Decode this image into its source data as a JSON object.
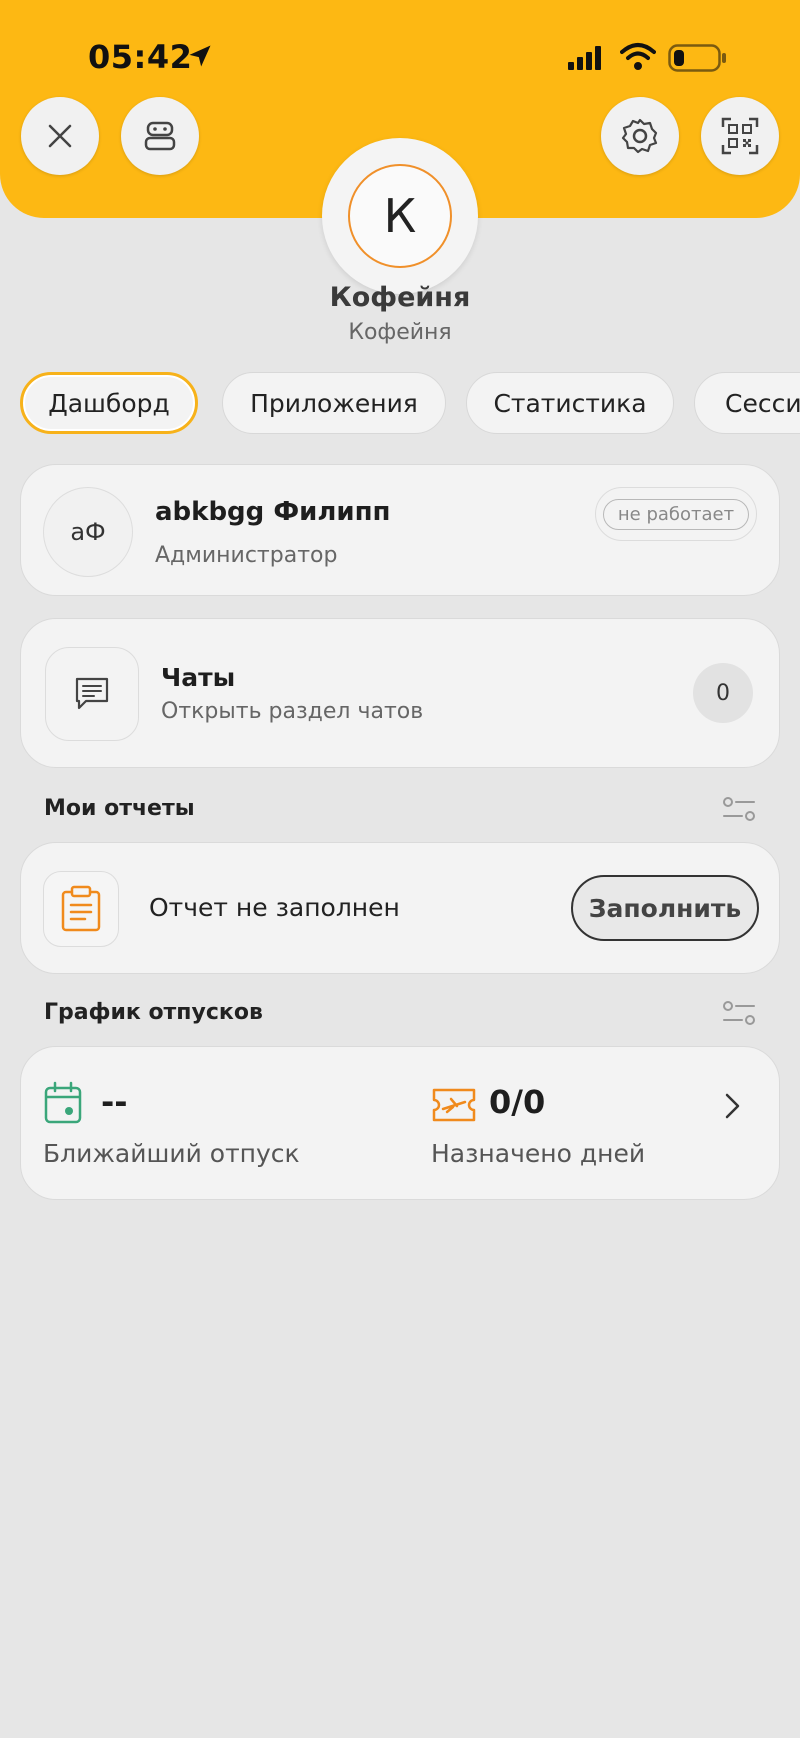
{
  "status_bar": {
    "time": "05:42"
  },
  "header": {
    "avatar_letter": "К",
    "org_name": "Кофейня",
    "org_subtitle": "Кофейня"
  },
  "tabs": [
    {
      "label": "Дашборд",
      "active": true
    },
    {
      "label": "Приложения",
      "active": false
    },
    {
      "label": "Статистика",
      "active": false
    },
    {
      "label": "Сессии",
      "active": false
    }
  ],
  "user_card": {
    "initials": "аФ",
    "name": "abkbgg Филипп",
    "role": "Администратор",
    "status": "не работает"
  },
  "chats_card": {
    "title": "Чаты",
    "subtitle": "Открыть раздел чатов",
    "count": "0"
  },
  "reports": {
    "section_title": "Мои отчеты",
    "status_text": "Отчет не заполнен",
    "fill_label": "Заполнить"
  },
  "vacations": {
    "section_title": "График отпусков",
    "nearest_value": "--",
    "nearest_label": "Ближайший отпуск",
    "days_value": "0/0",
    "days_label": "Назначено дней"
  },
  "colors": {
    "accent": "#fdb813",
    "avatar_ring": "#f0902a",
    "calendar_icon": "#3aa67a",
    "ticket_icon": "#f08a1c"
  }
}
